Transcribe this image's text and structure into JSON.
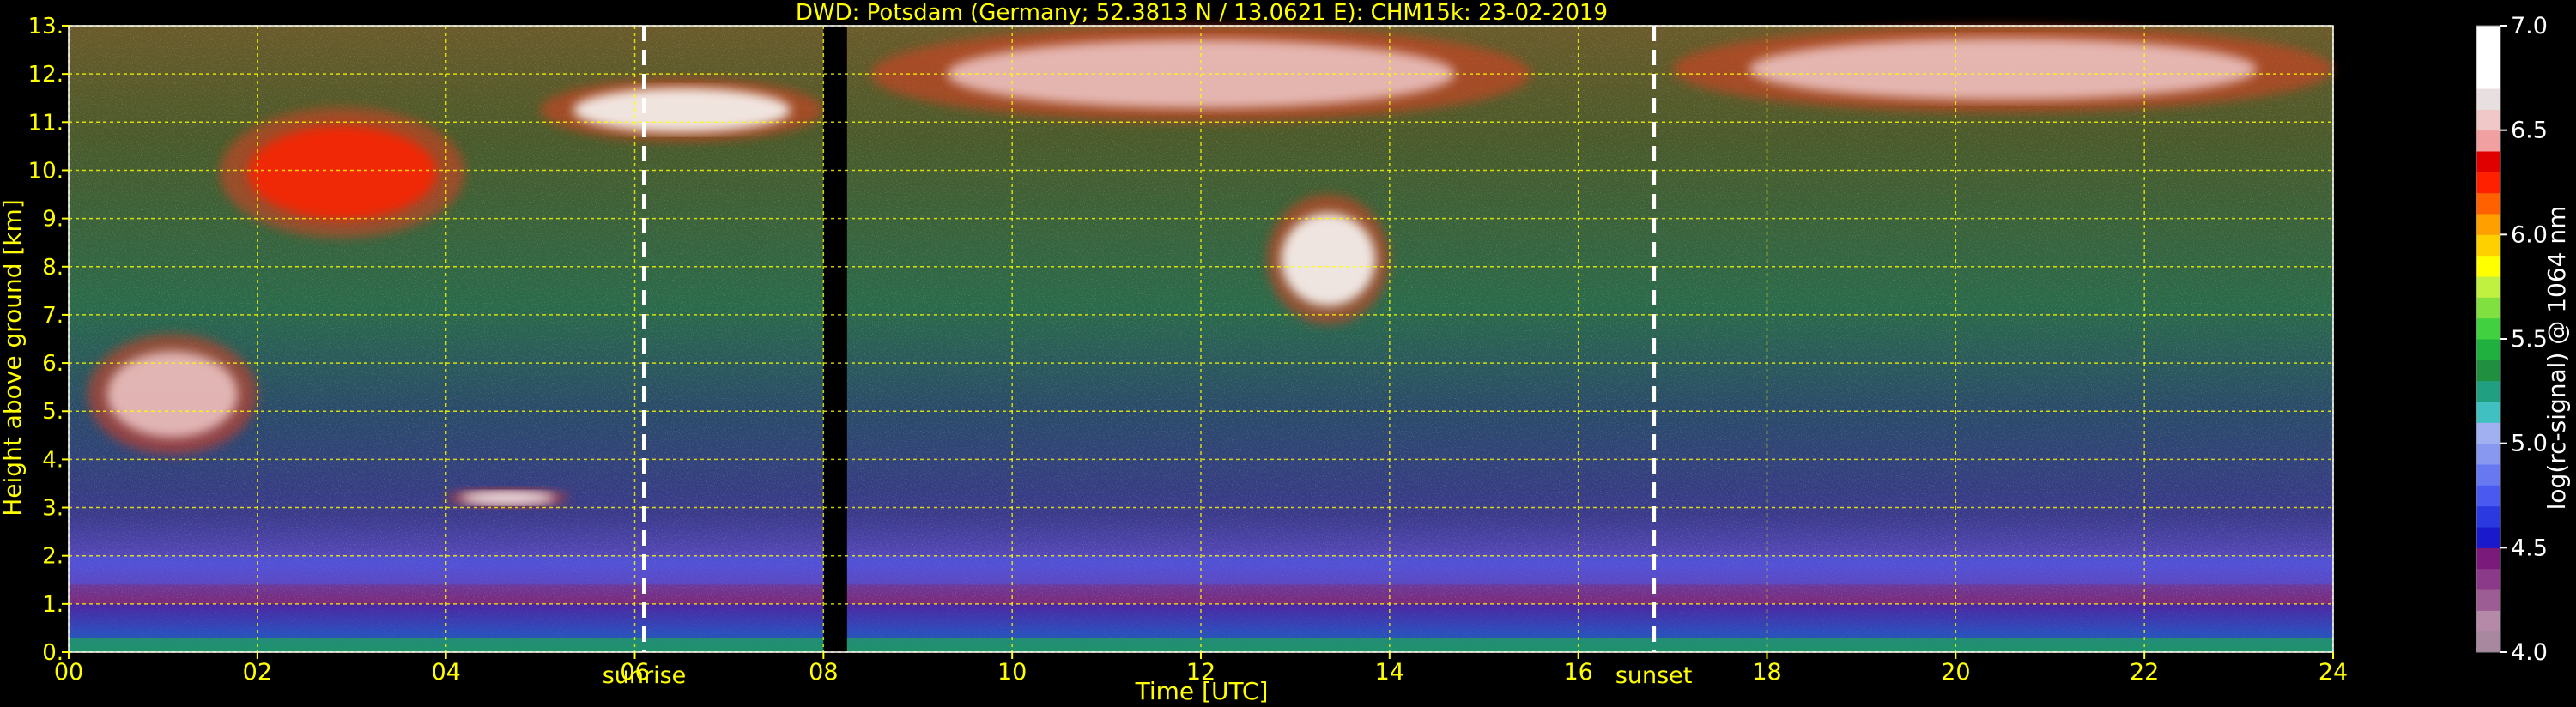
{
  "chart_data": {
    "type": "heatmap",
    "title": "DWD: Potsdam (Germany; 52.3813 N / 13.0621 E):    CHM15k: 23-02-2019",
    "xlabel": "Time [UTC]",
    "ylabel": "Height above ground [km]",
    "xlim": [
      0,
      24
    ],
    "ylim": [
      0,
      13
    ],
    "x_ticks": [
      "00",
      "02",
      "04",
      "06",
      "08",
      "10",
      "12",
      "14",
      "16",
      "18",
      "20",
      "22",
      "24"
    ],
    "y_ticks": [
      "0.",
      "1.",
      "2.",
      "3.",
      "4.",
      "5.",
      "6.",
      "7.",
      "8.",
      "9.",
      "10.",
      "11.",
      "12.",
      "13."
    ],
    "grid": true,
    "grid_color": "#ffff00",
    "annotations": [
      {
        "label": "sunrise",
        "x": 6.1
      },
      {
        "label": "sunset",
        "x": 16.8
      }
    ],
    "data_gap": [
      8.0,
      8.25
    ],
    "colorbar": {
      "label": "log(rc-signal) @ 1064 nm",
      "range": [
        4.0,
        7.0
      ],
      "ticks": [
        "4.0",
        "4.5",
        "5.0",
        "5.5",
        "6.0",
        "6.5",
        "7.0"
      ],
      "colors": [
        "#a8889e",
        "#b48aa8",
        "#9c5c94",
        "#8a3a88",
        "#7a1a7a",
        "#1a1acc",
        "#2a3ae0",
        "#4a5af0",
        "#6878f0",
        "#8898f0",
        "#a0b0f0",
        "#40c0c0",
        "#20a080",
        "#209040",
        "#20b040",
        "#40d040",
        "#80e040",
        "#c0f040",
        "#ffff00",
        "#ffd000",
        "#ffa000",
        "#ff6000",
        "#ff2000",
        "#e00000",
        "#f0a0a0",
        "#f0c8c8",
        "#e8e0e0",
        "#ffffff",
        "#ffffff",
        "#ffffff"
      ]
    },
    "features": [
      {
        "name": "boundary layer",
        "t_start": 0,
        "t_end": 24,
        "h_bottom": 0.0,
        "h_top": 1.0,
        "log_signal": 4.6
      },
      {
        "name": "residual layer",
        "t_start": 0,
        "t_end": 24,
        "h_bottom": 1.4,
        "h_top": 2.0,
        "log_signal": 4.7
      },
      {
        "name": "cloud",
        "t_start": 0.2,
        "t_end": 2.0,
        "h_bottom": 4.1,
        "h_top": 6.6,
        "log_signal": 6.5
      },
      {
        "name": "cloud",
        "t_start": 4.0,
        "t_end": 5.3,
        "h_bottom": 3.0,
        "h_top": 3.4,
        "log_signal": 7.0
      },
      {
        "name": "cloud",
        "t_start": 1.6,
        "t_end": 4.2,
        "h_bottom": 8.6,
        "h_top": 11.3,
        "log_signal": 6.2
      },
      {
        "name": "cloud",
        "t_start": 5.0,
        "t_end": 8.0,
        "h_bottom": 10.6,
        "h_top": 11.9,
        "log_signal": 7.0
      },
      {
        "name": "cloud",
        "t_start": 8.5,
        "t_end": 15.5,
        "h_bottom": 11.0,
        "h_top": 13.0,
        "log_signal": 6.6
      },
      {
        "name": "cloud",
        "t_start": 12.7,
        "t_end": 14.0,
        "h_bottom": 6.8,
        "h_top": 9.5,
        "log_signal": 7.0
      },
      {
        "name": "cloud",
        "t_start": 17.0,
        "t_end": 24.0,
        "h_bottom": 11.2,
        "h_top": 13.0,
        "log_signal": 6.5
      }
    ]
  }
}
